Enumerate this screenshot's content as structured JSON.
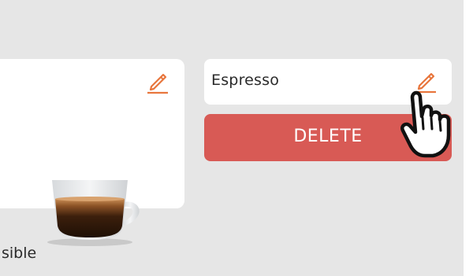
{
  "drink": {
    "name": "Espresso",
    "image_icon": "coffee-cup-icon"
  },
  "actions": {
    "delete_label": "DELETE",
    "edit_icon": "pencil-icon"
  },
  "footer": {
    "partial_text": "sible"
  },
  "cursor": {
    "icon": "hand-pointer-icon"
  },
  "colors": {
    "accent": "#e8763d",
    "delete": "#d85a55",
    "background": "#e6e6e6"
  }
}
